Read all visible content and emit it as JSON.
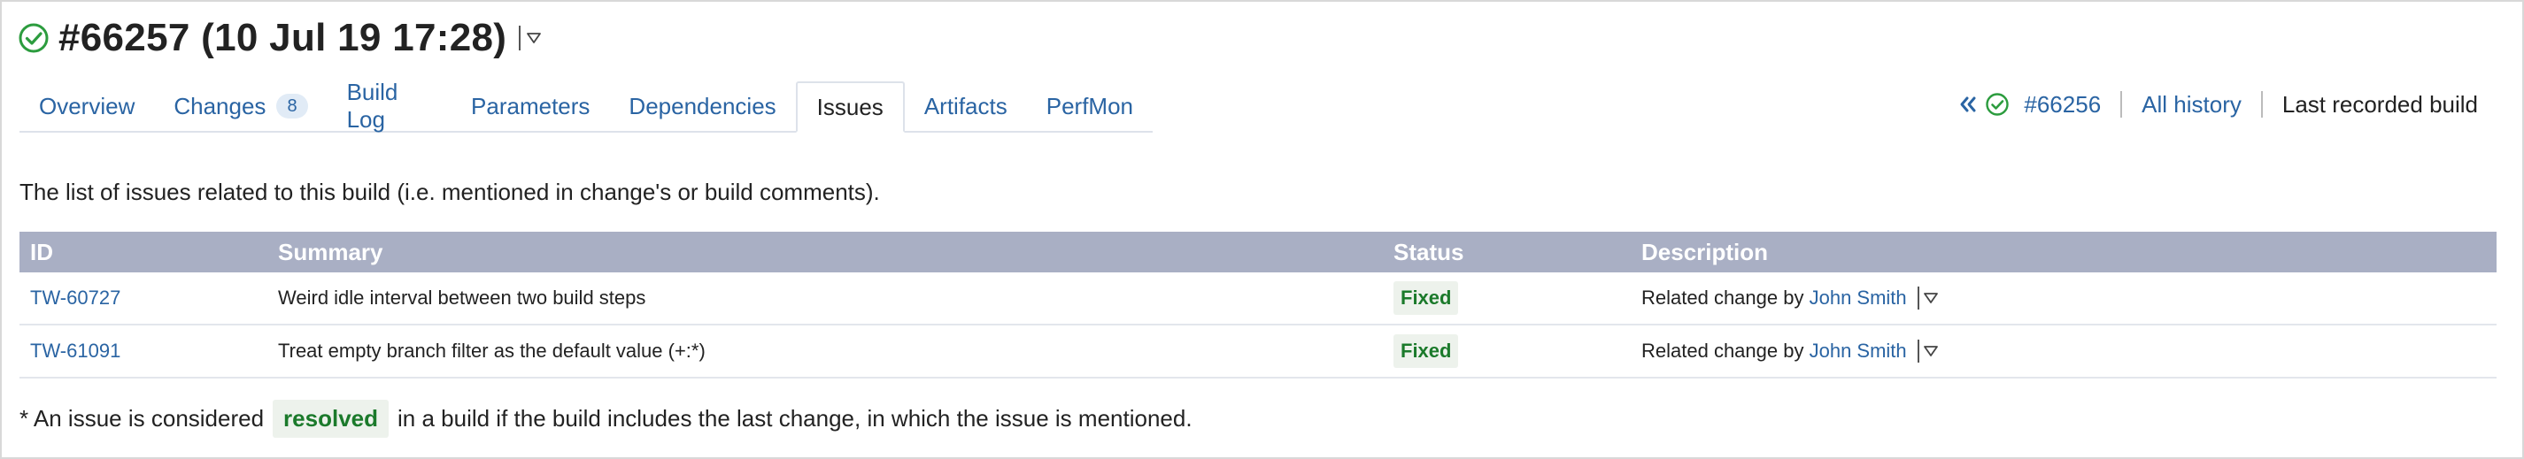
{
  "header": {
    "title": "#66257 (10 Jul 19 17:28)",
    "status_color": "#2c9c3e"
  },
  "tabs": [
    {
      "label": "Overview"
    },
    {
      "label": "Changes",
      "badge": "8"
    },
    {
      "label": "Build Log"
    },
    {
      "label": "Parameters"
    },
    {
      "label": "Dependencies"
    },
    {
      "label": "Issues",
      "active": true
    },
    {
      "label": "Artifacts"
    },
    {
      "label": "PerfMon"
    }
  ],
  "right_nav": {
    "prev_build": "#66256",
    "all_history": "All history",
    "last_recorded": "Last recorded build"
  },
  "intro": "The list of issues related to this build (i.e. mentioned in change's or build comments).",
  "table": {
    "headers": {
      "id": "ID",
      "summary": "Summary",
      "status": "Status",
      "description": "Description"
    },
    "rows": [
      {
        "id": "TW-60727",
        "summary": "Weird idle interval between two build steps",
        "status": "Fixed",
        "desc_prefix": "Related change by",
        "desc_author": "John Smith"
      },
      {
        "id": "TW-61091",
        "summary": "Treat empty branch filter as the default value (+:*)",
        "status": "Fixed",
        "desc_prefix": "Related change by",
        "desc_author": "John Smith"
      }
    ]
  },
  "footnote": {
    "before": "* An issue is considered",
    "highlight": "resolved",
    "after": "in a build if the build includes the last change, in which the issue is mentioned."
  },
  "colors": {
    "link": "#2a64a3",
    "table_header_bg": "#a9afc4",
    "fixed_text": "#1b7a2b",
    "fixed_bg": "#edf2ec"
  }
}
